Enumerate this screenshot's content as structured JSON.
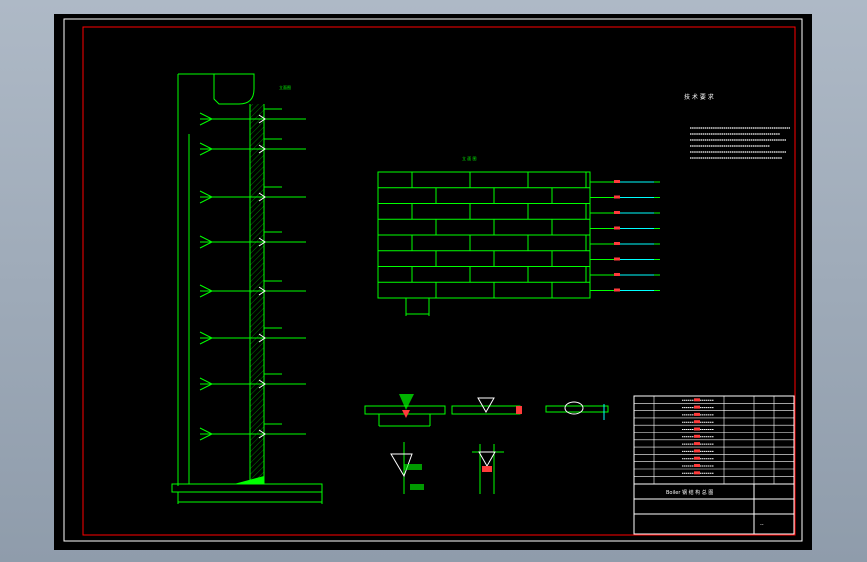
{
  "sheet": {
    "frame_color": "#ffffff",
    "border_color": "#ff0000",
    "line_color": "#00ff00",
    "background": "#000000"
  },
  "notes": {
    "title": "技 术 要 求",
    "color": "#ffffff"
  },
  "elevation": {
    "label": "立面图",
    "color": "#00ff00"
  },
  "title_block": {
    "drawing_title": "Boiler 钢 结 构 总 图",
    "code": "--"
  }
}
